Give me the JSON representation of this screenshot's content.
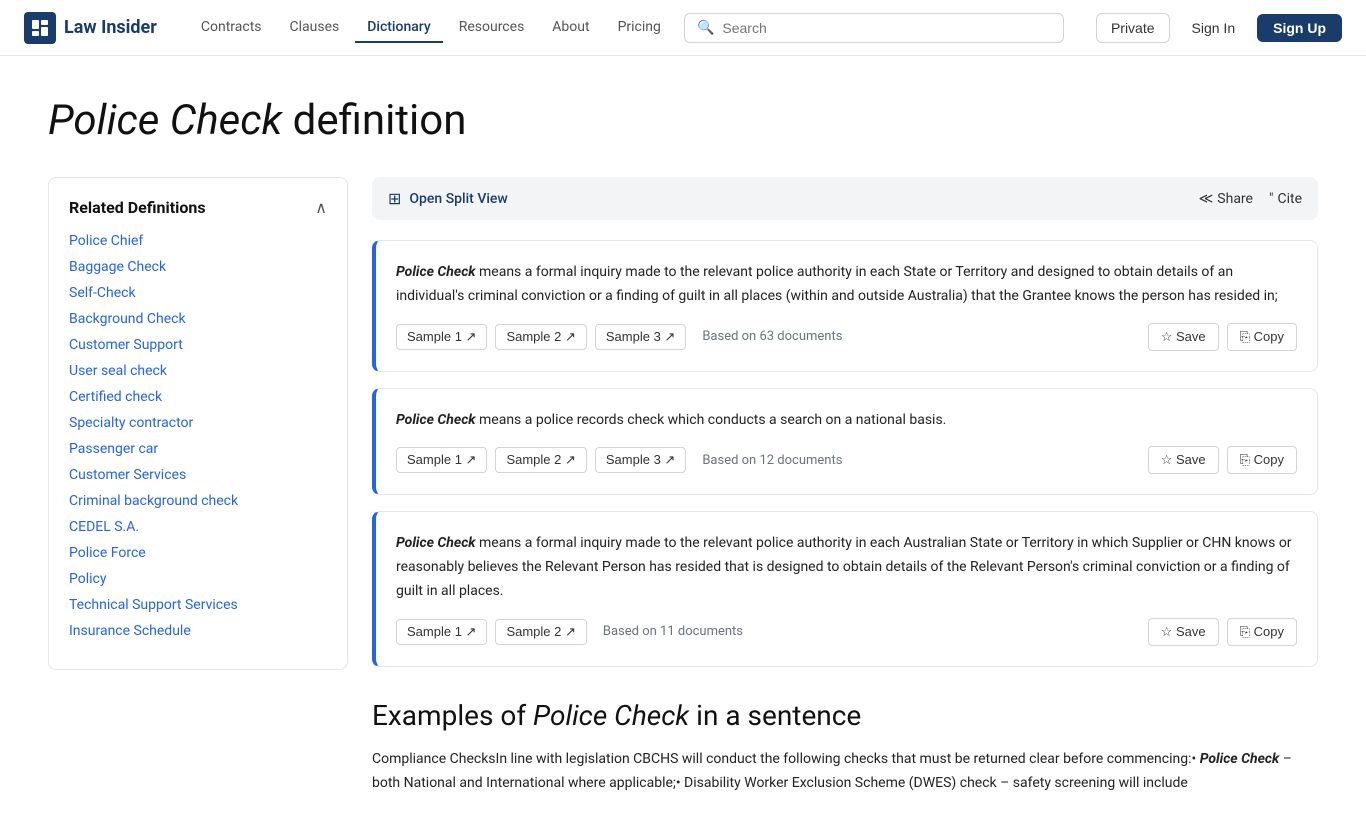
{
  "nav": {
    "logo_text": "Law Insider",
    "links": [
      {
        "label": "Contracts",
        "active": false
      },
      {
        "label": "Clauses",
        "active": false
      },
      {
        "label": "Dictionary",
        "active": true
      },
      {
        "label": "Resources",
        "active": false
      },
      {
        "label": "About",
        "active": false
      },
      {
        "label": "Pricing",
        "active": false
      }
    ],
    "search_placeholder": "Search",
    "btn_private": "Private",
    "btn_signin": "Sign In",
    "btn_signup": "Sign Up"
  },
  "page": {
    "title_italic": "Police Check",
    "title_rest": " definition"
  },
  "sidebar": {
    "title": "Related Definitions",
    "items": [
      "Police Chief",
      "Baggage Check",
      "Self-Check",
      "Background Check",
      "Customer Support",
      "User seal check",
      "Certified check",
      "Specialty contractor",
      "Passenger car",
      "Customer Services",
      "Criminal background check",
      "CEDEL S.A.",
      "Police Force",
      "Policy",
      "Technical Support Services",
      "Insurance Schedule"
    ]
  },
  "toolbar": {
    "open_split_view": "Open Split View",
    "share": "Share",
    "cite": "Cite"
  },
  "definitions": [
    {
      "term": "Police Check",
      "text": " means a formal inquiry made to the relevant police authority in each State or Territory and designed to obtain details of an individual's criminal conviction or a finding of guilt in all places (within and outside Australia) that the Grantee knows the person has resided in;",
      "samples": [
        "Sample 1",
        "Sample 2",
        "Sample 3"
      ],
      "based_on": "Based on 63 documents"
    },
    {
      "term": "Police Check",
      "text": " means a police records check which conducts a search on a national basis.",
      "samples": [
        "Sample 1",
        "Sample 2",
        "Sample 3"
      ],
      "based_on": "Based on 12 documents"
    },
    {
      "term": "Police Check",
      "text": " means a formal inquiry made to the relevant police authority in each Australian State or Territory in which Supplier or CHN knows or reasonably believes the Relevant Person has resided that is designed to obtain details of the Relevant Person's criminal conviction or a finding of guilt in all places.",
      "samples": [
        "Sample 1",
        "Sample 2"
      ],
      "based_on": "Based on 11 documents"
    }
  ],
  "examples": {
    "title_prefix": "Examples of ",
    "title_italic": "Police Check",
    "title_suffix": " in a sentence",
    "text": "Compliance ChecksIn line with legislation CBCHS will conduct the following checks that must be returned clear before commencing:• Police Check – both National and International where applicable;• Disability Worker Exclusion Scheme (DWES) check – safety screening will include"
  },
  "icons": {
    "search": "🔍",
    "split_view": "⊞",
    "share": "≪",
    "cite": "❝",
    "save": "☆",
    "copy": "⎘",
    "external": "↗",
    "chevron_up": "∧"
  }
}
